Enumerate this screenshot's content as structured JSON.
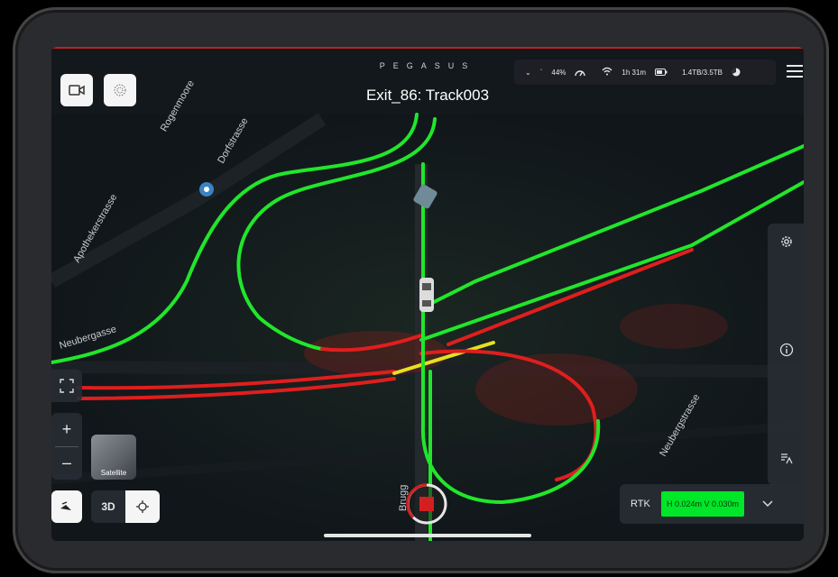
{
  "app": {
    "brand": "PEGASUS",
    "title": "Exit_86: Track003"
  },
  "status": {
    "battery_percent": "44%",
    "recording_time": "1h 31m",
    "storage": "1.4TB/3.5TB"
  },
  "map": {
    "street_labels": [
      "Rogenmoore",
      "Apothekerstrasse",
      "Dorfstrasse",
      "Neubergasse",
      "Brugg",
      "Neubergstrasse"
    ],
    "layer_thumb_label": "Satellite",
    "view_mode": "3D",
    "track_colors": {
      "good": "#21e62b",
      "bad": "#e01e1e",
      "warn": "#e6e020"
    }
  },
  "zoom": {
    "plus": "+",
    "minus": "–"
  },
  "rtk": {
    "label": "RTK",
    "value": "H 0.024m V 0.030m",
    "status_color": "#00e628"
  },
  "icons": {
    "camera": "camera-icon",
    "scan": "scan-icon",
    "menu": "menu-icon",
    "settings": "gear-icon",
    "info": "info-icon",
    "layers": "layers-icon",
    "expand": "expand-icon",
    "north": "compass-icon",
    "locate": "locate-icon",
    "record": "record-stop-icon",
    "chevron": "chevron-down-icon"
  }
}
